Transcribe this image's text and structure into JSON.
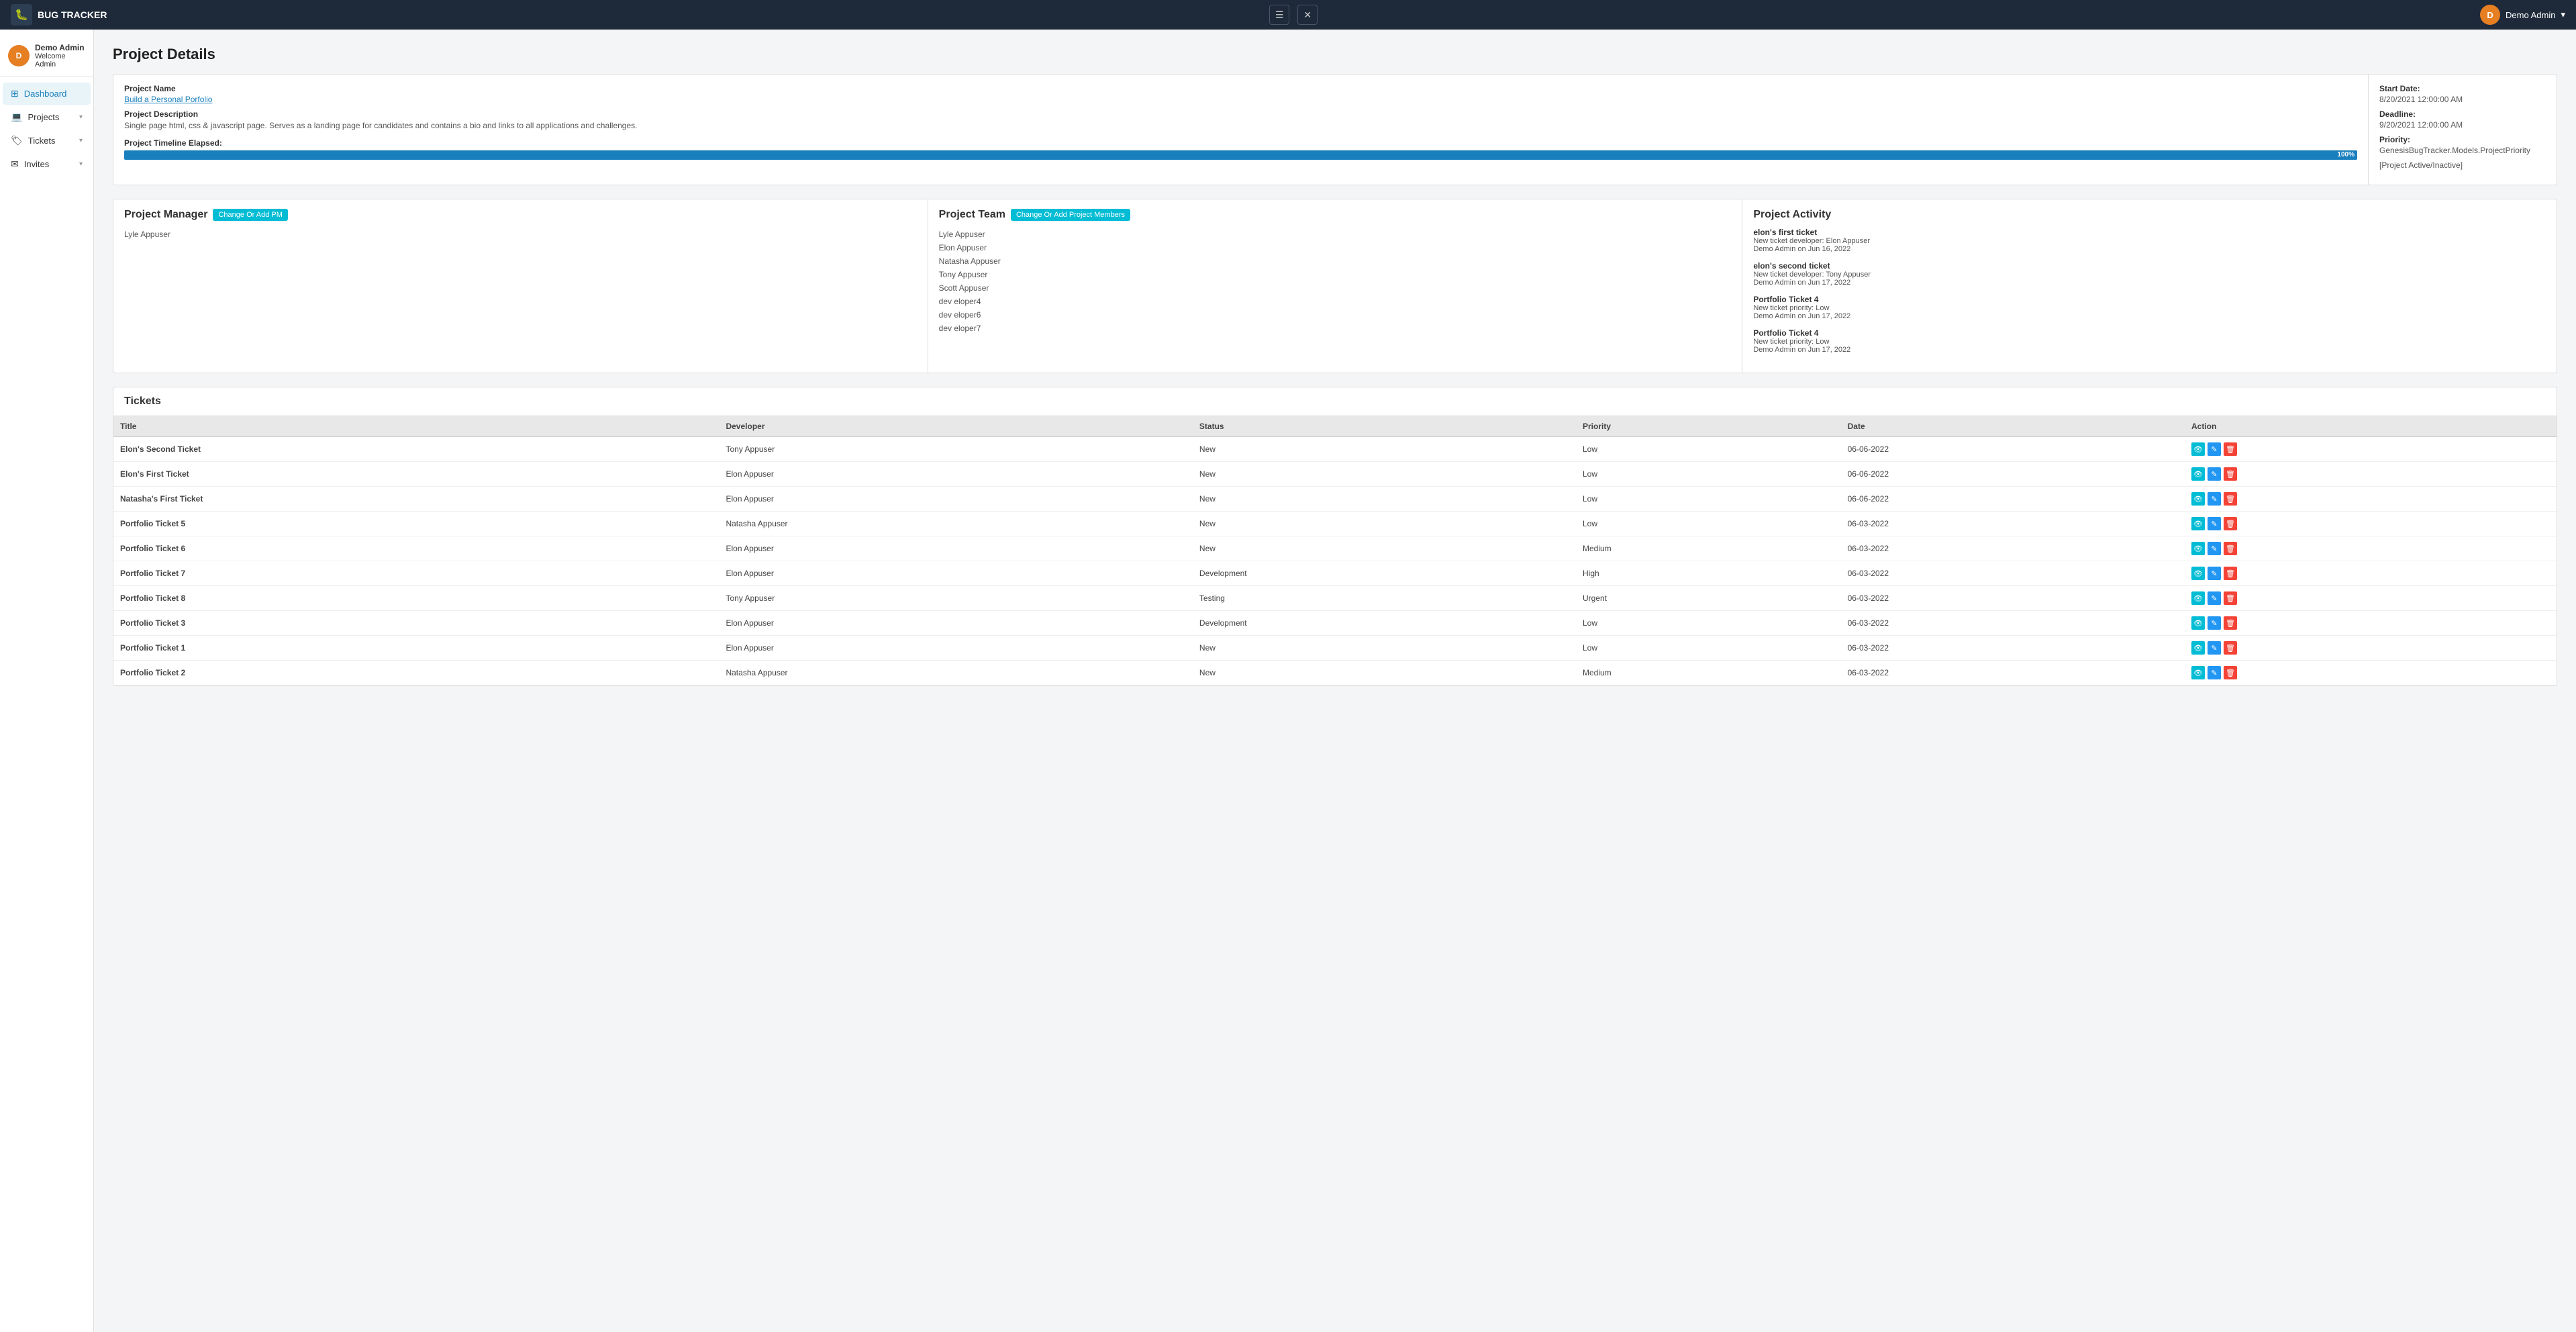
{
  "topNav": {
    "brand": "BUG TRACKER",
    "hamburgerLabel": "☰",
    "closeLabel": "✕",
    "user": {
      "name": "Demo Admin",
      "avatarInitial": "D"
    }
  },
  "sidebar": {
    "profile": {
      "name": "Demo Admin",
      "subtitle": "Welcome Admin",
      "avatarInitial": "D"
    },
    "items": [
      {
        "id": "dashboard",
        "label": "Dashboard",
        "icon": "⊞",
        "hasChevron": false,
        "active": true
      },
      {
        "id": "projects",
        "label": "Projects",
        "icon": "💻",
        "hasChevron": true,
        "active": false
      },
      {
        "id": "tickets",
        "label": "Tickets",
        "icon": "🏷",
        "hasChevron": true,
        "active": false
      },
      {
        "id": "invites",
        "label": "Invites",
        "icon": "✉",
        "hasChevron": true,
        "active": false
      }
    ]
  },
  "pageTitle": "Project Details",
  "projectDetails": {
    "nameLabel": "Project Name",
    "nameValue": "Build a Personal Porfolio",
    "descLabel": "Project Description",
    "descValue": "Single page html, css & javascript page. Serves as a landing page for candidates and contains a bio and links to all applications and challenges.",
    "timelineLabel": "Project Timeline Elapsed:",
    "progressPercent": 100,
    "progressText": "100%",
    "startDateLabel": "Start Date:",
    "startDateValue": "8/20/2021 12:00:00 AM",
    "deadlineLabel": "Deadline:",
    "deadlineValue": "9/20/2021 12:00:00 AM",
    "priorityLabel": "Priority:",
    "priorityValue": "GenesisBugTracker.Models.ProjectPriority",
    "statusValue": "[Project Active/Inactive]"
  },
  "projectManager": {
    "title": "Project Manager",
    "buttonLabel": "Change Or Add PM",
    "manager": "Lyle Appuser"
  },
  "projectTeam": {
    "title": "Project Team",
    "buttonLabel": "Change Or Add Project Members",
    "members": [
      "Lyle Appuser",
      "Elon Appuser",
      "Natasha Appuser",
      "Tony Appuser",
      "Scott Appuser",
      "dev eloper4",
      "dev eloper6",
      "dev eloper7"
    ]
  },
  "projectActivity": {
    "title": "Project Activity",
    "items": [
      {
        "title": "elon's first ticket",
        "line1": "New ticket developer: Elon Appuser",
        "line2": "Demo Admin on Jun 16, 2022"
      },
      {
        "title": "elon's second ticket",
        "line1": "New ticket developer: Tony Appuser",
        "line2": "Demo Admin on Jun 17, 2022"
      },
      {
        "title": "Portfolio Ticket 4",
        "line1": "New ticket priority: Low",
        "line2": "Demo Admin on Jun 17, 2022"
      },
      {
        "title": "Portfolio Ticket 4",
        "line1": "New ticket priority: Low",
        "line2": "Demo Admin on Jun 17, 2022"
      }
    ]
  },
  "tickets": {
    "sectionTitle": "Tickets",
    "columns": {
      "title": "Title",
      "developer": "Developer",
      "status": "Status",
      "priority": "Priority",
      "date": "Date",
      "action": "Action"
    },
    "rows": [
      {
        "title": "Elon's Second Ticket",
        "developer": "Tony Appuser",
        "status": "New",
        "priority": "Low",
        "date": "06-06-2022"
      },
      {
        "title": "Elon's First Ticket",
        "developer": "Elon Appuser",
        "status": "New",
        "priority": "Low",
        "date": "06-06-2022"
      },
      {
        "title": "Natasha's First Ticket",
        "developer": "Elon Appuser",
        "status": "New",
        "priority": "Low",
        "date": "06-06-2022"
      },
      {
        "title": "Portfolio Ticket 5",
        "developer": "Natasha Appuser",
        "status": "New",
        "priority": "Low",
        "date": "06-03-2022"
      },
      {
        "title": "Portfolio Ticket 6",
        "developer": "Elon Appuser",
        "status": "New",
        "priority": "Medium",
        "date": "06-03-2022"
      },
      {
        "title": "Portfolio Ticket 7",
        "developer": "Elon Appuser",
        "status": "Development",
        "priority": "High",
        "date": "06-03-2022"
      },
      {
        "title": "Portfolio Ticket 8",
        "developer": "Tony Appuser",
        "status": "Testing",
        "priority": "Urgent",
        "date": "06-03-2022"
      },
      {
        "title": "Portfolio Ticket 3",
        "developer": "Elon Appuser",
        "status": "Development",
        "priority": "Low",
        "date": "06-03-2022"
      },
      {
        "title": "Portfolio Ticket 1",
        "developer": "Elon Appuser",
        "status": "New",
        "priority": "Low",
        "date": "06-03-2022"
      },
      {
        "title": "Portfolio Ticket 2",
        "developer": "Natasha Appuser",
        "status": "New",
        "priority": "Medium",
        "date": "06-03-2022"
      }
    ]
  }
}
